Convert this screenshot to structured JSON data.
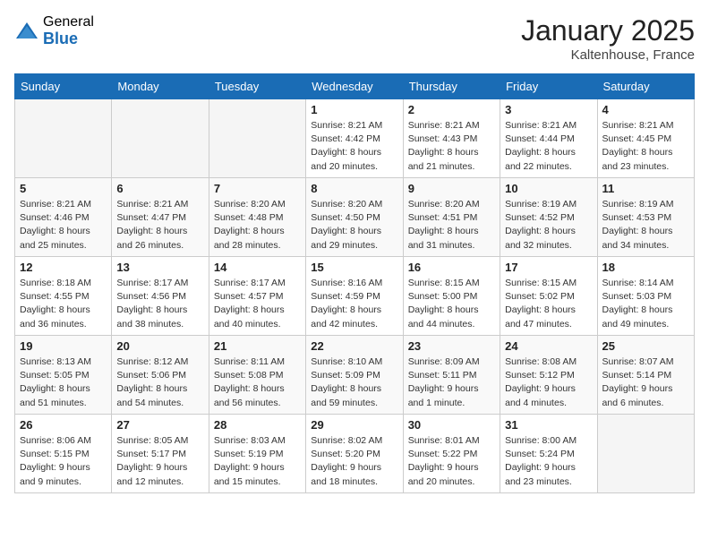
{
  "header": {
    "logo_general": "General",
    "logo_blue": "Blue",
    "title": "January 2025",
    "subtitle": "Kaltenhouse, France"
  },
  "weekdays": [
    "Sunday",
    "Monday",
    "Tuesday",
    "Wednesday",
    "Thursday",
    "Friday",
    "Saturday"
  ],
  "weeks": [
    [
      {
        "day": "",
        "info": ""
      },
      {
        "day": "",
        "info": ""
      },
      {
        "day": "",
        "info": ""
      },
      {
        "day": "1",
        "info": "Sunrise: 8:21 AM\nSunset: 4:42 PM\nDaylight: 8 hours\nand 20 minutes."
      },
      {
        "day": "2",
        "info": "Sunrise: 8:21 AM\nSunset: 4:43 PM\nDaylight: 8 hours\nand 21 minutes."
      },
      {
        "day": "3",
        "info": "Sunrise: 8:21 AM\nSunset: 4:44 PM\nDaylight: 8 hours\nand 22 minutes."
      },
      {
        "day": "4",
        "info": "Sunrise: 8:21 AM\nSunset: 4:45 PM\nDaylight: 8 hours\nand 23 minutes."
      }
    ],
    [
      {
        "day": "5",
        "info": "Sunrise: 8:21 AM\nSunset: 4:46 PM\nDaylight: 8 hours\nand 25 minutes."
      },
      {
        "day": "6",
        "info": "Sunrise: 8:21 AM\nSunset: 4:47 PM\nDaylight: 8 hours\nand 26 minutes."
      },
      {
        "day": "7",
        "info": "Sunrise: 8:20 AM\nSunset: 4:48 PM\nDaylight: 8 hours\nand 28 minutes."
      },
      {
        "day": "8",
        "info": "Sunrise: 8:20 AM\nSunset: 4:50 PM\nDaylight: 8 hours\nand 29 minutes."
      },
      {
        "day": "9",
        "info": "Sunrise: 8:20 AM\nSunset: 4:51 PM\nDaylight: 8 hours\nand 31 minutes."
      },
      {
        "day": "10",
        "info": "Sunrise: 8:19 AM\nSunset: 4:52 PM\nDaylight: 8 hours\nand 32 minutes."
      },
      {
        "day": "11",
        "info": "Sunrise: 8:19 AM\nSunset: 4:53 PM\nDaylight: 8 hours\nand 34 minutes."
      }
    ],
    [
      {
        "day": "12",
        "info": "Sunrise: 8:18 AM\nSunset: 4:55 PM\nDaylight: 8 hours\nand 36 minutes."
      },
      {
        "day": "13",
        "info": "Sunrise: 8:17 AM\nSunset: 4:56 PM\nDaylight: 8 hours\nand 38 minutes."
      },
      {
        "day": "14",
        "info": "Sunrise: 8:17 AM\nSunset: 4:57 PM\nDaylight: 8 hours\nand 40 minutes."
      },
      {
        "day": "15",
        "info": "Sunrise: 8:16 AM\nSunset: 4:59 PM\nDaylight: 8 hours\nand 42 minutes."
      },
      {
        "day": "16",
        "info": "Sunrise: 8:15 AM\nSunset: 5:00 PM\nDaylight: 8 hours\nand 44 minutes."
      },
      {
        "day": "17",
        "info": "Sunrise: 8:15 AM\nSunset: 5:02 PM\nDaylight: 8 hours\nand 47 minutes."
      },
      {
        "day": "18",
        "info": "Sunrise: 8:14 AM\nSunset: 5:03 PM\nDaylight: 8 hours\nand 49 minutes."
      }
    ],
    [
      {
        "day": "19",
        "info": "Sunrise: 8:13 AM\nSunset: 5:05 PM\nDaylight: 8 hours\nand 51 minutes."
      },
      {
        "day": "20",
        "info": "Sunrise: 8:12 AM\nSunset: 5:06 PM\nDaylight: 8 hours\nand 54 minutes."
      },
      {
        "day": "21",
        "info": "Sunrise: 8:11 AM\nSunset: 5:08 PM\nDaylight: 8 hours\nand 56 minutes."
      },
      {
        "day": "22",
        "info": "Sunrise: 8:10 AM\nSunset: 5:09 PM\nDaylight: 8 hours\nand 59 minutes."
      },
      {
        "day": "23",
        "info": "Sunrise: 8:09 AM\nSunset: 5:11 PM\nDaylight: 9 hours\nand 1 minute."
      },
      {
        "day": "24",
        "info": "Sunrise: 8:08 AM\nSunset: 5:12 PM\nDaylight: 9 hours\nand 4 minutes."
      },
      {
        "day": "25",
        "info": "Sunrise: 8:07 AM\nSunset: 5:14 PM\nDaylight: 9 hours\nand 6 minutes."
      }
    ],
    [
      {
        "day": "26",
        "info": "Sunrise: 8:06 AM\nSunset: 5:15 PM\nDaylight: 9 hours\nand 9 minutes."
      },
      {
        "day": "27",
        "info": "Sunrise: 8:05 AM\nSunset: 5:17 PM\nDaylight: 9 hours\nand 12 minutes."
      },
      {
        "day": "28",
        "info": "Sunrise: 8:03 AM\nSunset: 5:19 PM\nDaylight: 9 hours\nand 15 minutes."
      },
      {
        "day": "29",
        "info": "Sunrise: 8:02 AM\nSunset: 5:20 PM\nDaylight: 9 hours\nand 18 minutes."
      },
      {
        "day": "30",
        "info": "Sunrise: 8:01 AM\nSunset: 5:22 PM\nDaylight: 9 hours\nand 20 minutes."
      },
      {
        "day": "31",
        "info": "Sunrise: 8:00 AM\nSunset: 5:24 PM\nDaylight: 9 hours\nand 23 minutes."
      },
      {
        "day": "",
        "info": ""
      }
    ]
  ]
}
